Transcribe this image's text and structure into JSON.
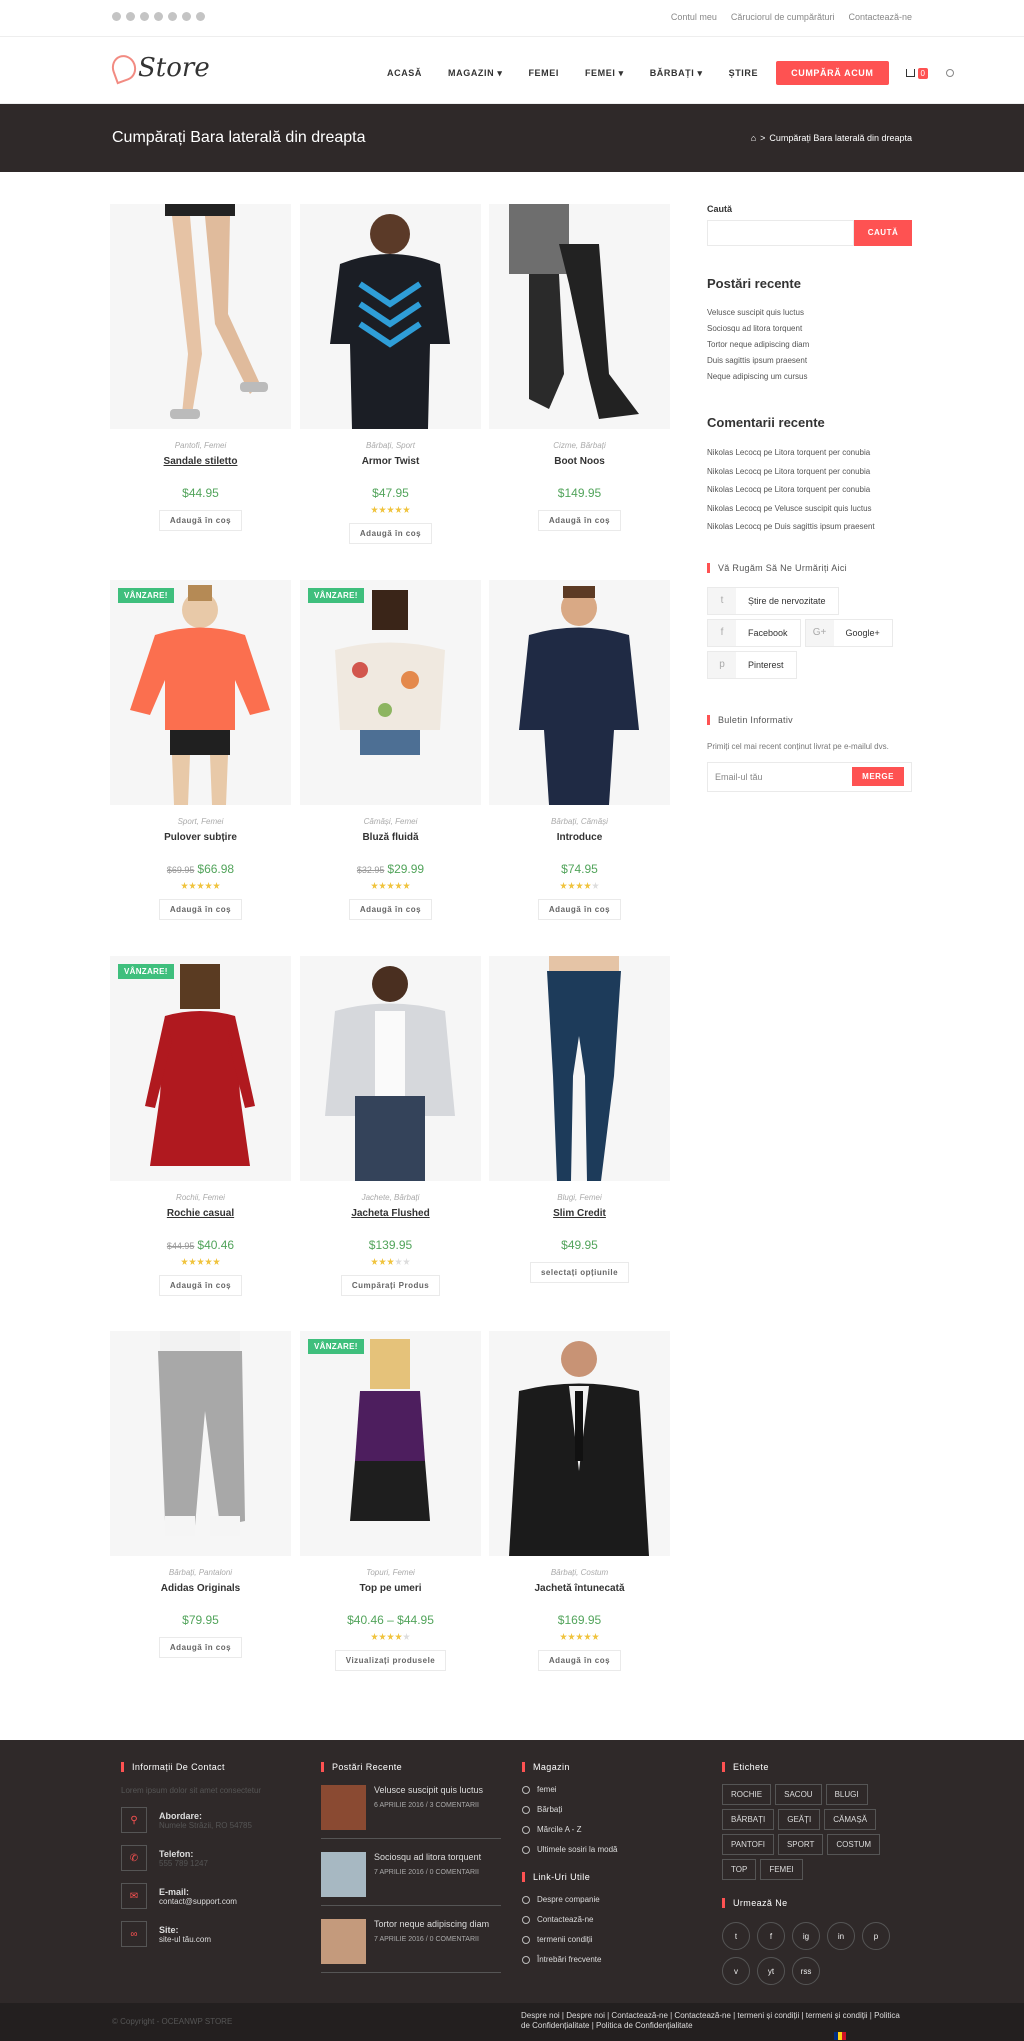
{
  "topbar": {
    "social_icons": [
      "twitter-icon",
      "facebook-icon",
      "pinterest-icon",
      "dribbble-icon",
      "youtube-icon",
      "vimeo-icon",
      "rss-icon"
    ],
    "links": [
      "Contul meu",
      "Căruciorul de cumpărături",
      "Contactează-ne"
    ]
  },
  "header": {
    "logo": "Store",
    "nav": [
      {
        "label": "ACASĂ",
        "dropdown": false
      },
      {
        "label": "MAGAZIN",
        "dropdown": true
      },
      {
        "label": "FEMEI",
        "dropdown": false
      },
      {
        "label": "FEMEI",
        "dropdown": true
      },
      {
        "label": "BĂRBAȚI",
        "dropdown": true
      },
      {
        "label": "ȘTIRE",
        "dropdown": false
      }
    ],
    "cta": "CUMPĂRĂ ACUM",
    "cart_count": "0"
  },
  "banner": {
    "title": "Cumpărați Bara laterală din dreapta",
    "crumb": "Cumpărați Bara laterală din dreapta"
  },
  "products": [
    {
      "cat": "Pantofi, Femei",
      "name": "Sandale stiletto",
      "old": "",
      "price": "$44.95",
      "rating": 0,
      "button": "Adaugă în coș",
      "sale": "",
      "img": "legs"
    },
    {
      "cat": "Bărbați, Sport",
      "name": "Armor Twist",
      "old": "",
      "price": "$47.95",
      "rating": 5,
      "button": "Adaugă în coș",
      "sale": "",
      "img": "tee"
    },
    {
      "cat": "Cizme, Bărbați",
      "name": "Boot Noos",
      "old": "",
      "price": "$149.95",
      "rating": 0,
      "button": "Adaugă în coș",
      "sale": "",
      "img": "boots"
    },
    {
      "cat": "Sport, Femei",
      "name": "Pulover subțire",
      "old": "$69.95",
      "price": "$66.98",
      "rating": 5,
      "button": "Adaugă în coș",
      "sale": "VÂNZARE!",
      "img": "sweater"
    },
    {
      "cat": "Cămăși, Femei",
      "name": "Bluză fluidă",
      "old": "$32.95",
      "price": "$29.99",
      "rating": 5,
      "button": "Adaugă în coș",
      "sale": "VÂNZARE!",
      "img": "blouse"
    },
    {
      "cat": "Bărbați, Cămăși",
      "name": "Introduce",
      "old": "",
      "price": "$74.95",
      "rating": 4,
      "button": "Adaugă în coș",
      "sale": "",
      "img": "shirt"
    },
    {
      "cat": "Rochii, Femei",
      "name": "Rochie casual",
      "old": "$44.95",
      "price": "$40.46",
      "rating": 5,
      "button": "Adaugă în coș",
      "sale": "VÂNZARE!",
      "img": "dress"
    },
    {
      "cat": "Jachete, Bărbați",
      "name": "Jacheta Flushed",
      "old": "",
      "price": "$139.95",
      "rating": 3,
      "button": "Cumpărați Produs",
      "sale": "",
      "img": "jacket"
    },
    {
      "cat": "Blugi, Femei",
      "name": "Slim Credit",
      "old": "",
      "price": "$49.95",
      "rating": 0,
      "button": "selectați opțiunile",
      "sale": "",
      "img": "jeans"
    },
    {
      "cat": "Bărbați, Pantaloni",
      "name": "Adidas Originals",
      "old": "",
      "price": "$79.95",
      "rating": 0,
      "button": "Adaugă în coș",
      "sale": "",
      "img": "pants"
    },
    {
      "cat": "Topuri, Femei",
      "name": "Top pe umeri",
      "old": "",
      "price": "$40.46 – $44.95",
      "rating": 4,
      "button": "Vizualizați produsele",
      "sale": "VÂNZARE!",
      "img": "top"
    },
    {
      "cat": "Bărbați, Costum",
      "name": "Jachetă întunecată",
      "old": "",
      "price": "$169.95",
      "rating": 5,
      "button": "Adaugă în coș",
      "sale": "",
      "img": "suit"
    }
  ],
  "sidebar": {
    "search_label": "Caută",
    "search_button": "CAUTĂ",
    "recent_posts_title": "Postări recente",
    "recent_posts": [
      "Velusce suscipit quis luctus",
      "Sociosqu ad litora torquent",
      "Tortor neque adipiscing diam",
      "Duis sagittis ipsum praesent",
      "Neque adipiscing um cursus"
    ],
    "recent_comments_title": "Comentarii recente",
    "recent_comments": [
      "Nikolas Lecocq pe Litora torquent per conubia",
      "Nikolas Lecocq pe Litora torquent per conubia",
      "Nikolas Lecocq pe Litora torquent per conubia",
      "Nikolas Lecocq pe Velusce suscipit quis luctus",
      "Nikolas Lecocq pe Duis sagittis ipsum praesent"
    ],
    "follow_title": "Vă Rugăm Să Ne Urmăriți Aici",
    "follow": [
      [
        {
          "icon": "twitter-icon",
          "glyph": "t",
          "label": "Știre de nervozitate"
        }
      ],
      [
        {
          "icon": "facebook-icon",
          "glyph": "f",
          "label": "Facebook"
        },
        {
          "icon": "google-plus-icon",
          "glyph": "G+",
          "label": "Google+"
        }
      ],
      [
        {
          "icon": "pinterest-icon",
          "glyph": "p",
          "label": "Pinterest"
        }
      ]
    ],
    "newsletter_title": "Buletin Informativ",
    "newsletter_desc": "Primiți cel mai recent conținut livrat pe e-mailul dvs.",
    "newsletter_placeholder": "Email-ul tău",
    "newsletter_button": "MERGE"
  },
  "footer": {
    "contact_title": "Informații De Contact",
    "contact_desc": "Lorem ipsum dolor sit amet consectetur",
    "contact": [
      {
        "icon": "map-marker-icon",
        "title": "Abordare:",
        "value": "Numele Străzii, RO 54785",
        "dim": true
      },
      {
        "icon": "phone-icon",
        "title": "Telefon:",
        "value": "555 789 1247",
        "dim": true
      },
      {
        "icon": "envelope-icon",
        "title": "E-mail:",
        "value": "contact@support.com",
        "dim": false
      },
      {
        "icon": "link-icon",
        "title": "Site:",
        "value": "site-ul tău.com",
        "dim": false
      }
    ],
    "recent_title": "Postări Recente",
    "recent": [
      {
        "title": "Velusce suscipit quis luctus",
        "date": "6 APRILIE 2016 / 3 COMENTARII",
        "color": "#8a4a32"
      },
      {
        "title": "Sociosqu ad litora torquent",
        "date": "7 APRILIE 2016 / 0 COMENTARII",
        "color": "#a7b8c2"
      },
      {
        "title": "Tortor neque adipiscing diam",
        "date": "7 APRILIE 2016 / 0 COMENTARII",
        "color": "#c49a7c"
      }
    ],
    "shop_title": "Magazin",
    "shop": [
      "femei",
      "Bărbați",
      "Mărcile A - Z",
      "Ultimele sosiri la modă"
    ],
    "useful_title": "Link-Uri Utile",
    "useful": [
      "Despre companie",
      "Contactează-ne",
      "termenii condiții",
      "Întrebări frecvente"
    ],
    "tags_title": "Etichete",
    "tags": [
      "ROCHIE",
      "SACOU",
      "BLUGI",
      "BĂRBAȚI",
      "GEĂȚI",
      "CĂMAȘĂ",
      "PANTOFI",
      "SPORT",
      "COSTUM",
      "TOP",
      "FEMEI"
    ],
    "follow_title": "Urmează Ne",
    "follow_icons": [
      {
        "icon": "twitter-icon",
        "glyph": "t"
      },
      {
        "icon": "facebook-icon",
        "glyph": "f"
      },
      {
        "icon": "instagram-icon",
        "glyph": "ig"
      },
      {
        "icon": "linkedin-icon",
        "glyph": "in"
      },
      {
        "icon": "pinterest-icon",
        "glyph": "p"
      },
      {
        "icon": "vimeo-icon",
        "glyph": "v"
      },
      {
        "icon": "youtube-icon",
        "glyph": "yt"
      },
      {
        "icon": "rss-icon",
        "glyph": "rss"
      }
    ]
  },
  "bottom": {
    "copyright": "© Copyright - OCEANWP STORE",
    "links": "Despre noi | Despre noi | Contactează-ne | Contactează-ne | termeni și condiții | termeni și condiții | Politica de Confidențialitate | Politica de Confidențialitate"
  }
}
